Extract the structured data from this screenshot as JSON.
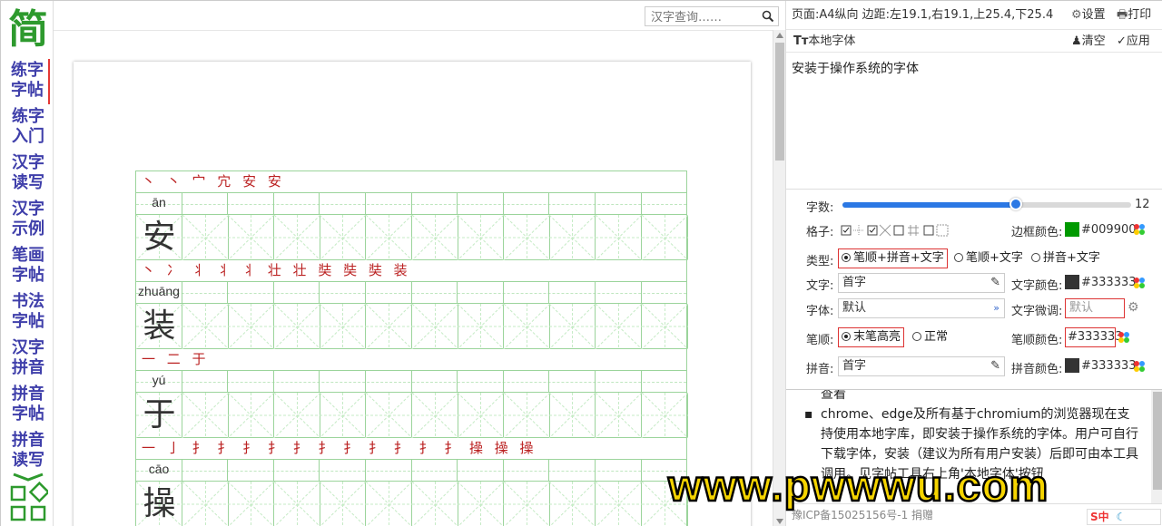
{
  "nav": {
    "logo": "简",
    "items": [
      {
        "line1": "练字",
        "line2": "字帖"
      },
      {
        "line1": "练字",
        "line2": "入门"
      },
      {
        "line1": "汉字",
        "line2": "读写"
      },
      {
        "line1": "汉字",
        "line2": "示例"
      },
      {
        "line1": "笔画",
        "line2": "字帖"
      },
      {
        "line1": "书法",
        "line2": "字帖"
      },
      {
        "line1": "汉字",
        "line2": "拼音"
      },
      {
        "line1": "拼音",
        "line2": "字帖"
      },
      {
        "line1": "拼音",
        "line2": "读写"
      }
    ]
  },
  "search": {
    "placeholder": "汉字查询……"
  },
  "worksheet": {
    "rows": [
      {
        "strokes": "丶 丶 宀 宂 安 安",
        "pinyin": "ān",
        "char": "安"
      },
      {
        "strokes": "丶 冫 丬 丬 丬 壮 壮 奘 奘 奘 装",
        "pinyin": "zhuāng",
        "char": "装"
      },
      {
        "strokes": "一 二 于",
        "pinyin": "yú",
        "char": "于"
      },
      {
        "strokes": "一 亅 扌 扌 扌 扌 扌 扌 扌 扌 扌 扌 扌 操 操 操",
        "pinyin": "cāo",
        "char": "操"
      }
    ]
  },
  "right": {
    "page_info": "页面:A4纵向 边距:左19.1,右19.1,上25.4,下25.4",
    "settings_btn": "设置",
    "print_btn": "打印",
    "local_font_title": "本地字体",
    "clear_btn": "清空",
    "apply_btn": "应用",
    "font_list_item": "安装于操作系统的字体",
    "word_count_label": "字数:",
    "word_count": "12",
    "word_count_fraction": 0.6,
    "grid_label": "格子:",
    "border_color_label": "边框颜色:",
    "border_color": "#009900",
    "type_label": "类型:",
    "type_options": [
      "笔顺+拼音+文字",
      "笔顺+文字",
      "拼音+文字"
    ],
    "text_label": "文字:",
    "text_value": "首字",
    "text_color_label": "文字颜色:",
    "text_color": "#333333",
    "font_label": "字体:",
    "font_value": "默认",
    "text_tune_label": "文字微调:",
    "text_tune_value": "默认",
    "stroke_label": "笔顺:",
    "stroke_options": [
      "末笔高亮",
      "正常"
    ],
    "stroke_color_label": "笔顺颜色:",
    "stroke_color": "#333333",
    "pinyin_label": "拼音:",
    "pinyin_value": "首字",
    "pinyin_color_label": "拼音颜色:",
    "pinyin_color": "#333333",
    "help_line0": "查看",
    "help_text": "chrome、edge及所有基于chromium的浏览器现在支持使用本地字库，即安装于操作系统的字体。用户可自行下载字体，安装（建议为所有用户安装）后即可由本工具调用。见字帖工具右上角'本地字体'按钮",
    "footer": "豫ICP备15025156号-1   捐赠"
  },
  "watermark": "www.pwwwu.com",
  "ime": "S中"
}
